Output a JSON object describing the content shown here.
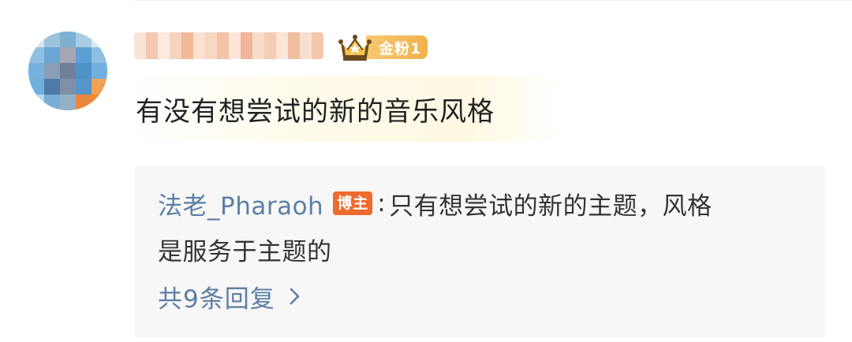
{
  "comment": {
    "username_visible": false,
    "fan_badge": {
      "label": "金粉1",
      "icon": "crown-icon",
      "color": "#f2b14b"
    },
    "text": "有没有想尝试的新的音乐风格"
  },
  "reply": {
    "author": "法老_Pharaoh",
    "author_badge": "博主",
    "separator": ":",
    "text_line1": "只有想尝试的新的主题，风格",
    "text_line2": "是服务于主题的",
    "link_color": "#5c7fa5",
    "badge_color": "#ef6a2e"
  },
  "reply_count": {
    "label": "共9条回复",
    "icon": "chevron-right-icon"
  }
}
